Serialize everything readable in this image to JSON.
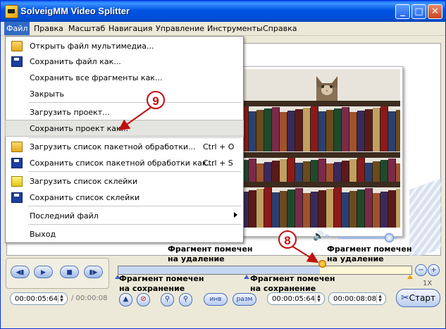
{
  "window": {
    "title": "SolveigMM Video Splitter",
    "buttons": {
      "minimize": "_",
      "maximize": "□",
      "close": "✕"
    }
  },
  "menubar": {
    "items": [
      "Файл",
      "Правка",
      "Масштаб",
      "Навигация",
      "Управление",
      "Инструменты",
      "Справка"
    ]
  },
  "file_menu": {
    "items": [
      {
        "label": "Открыть файл мультимедиа...",
        "icon": "folder-open-icon"
      },
      {
        "label": "Сохранить файл как...",
        "icon": "floppy-disk-icon"
      },
      {
        "label": "Сохранить все фрагменты как..."
      },
      {
        "label": "Закрыть"
      },
      {
        "label": "Загрузить проект..."
      },
      {
        "label": "Сохранить проект как...",
        "highlighted": true
      },
      {
        "label": "Загрузить список пакетной обработки...",
        "shortcut": "Ctrl + O",
        "icon": "folder-open-icon"
      },
      {
        "label": "Сохранить список пакетной обработки как...",
        "shortcut": "Ctrl + S",
        "icon": "floppy-disk-icon"
      },
      {
        "label": "Загрузить список склейки",
        "icon": "yellow-folder-icon"
      },
      {
        "label": "Сохранить список склейки",
        "icon": "floppy-disk-icon"
      },
      {
        "label": "Последний файл",
        "submenu": true
      },
      {
        "label": "Выход"
      }
    ]
  },
  "callouts": {
    "nine": "9",
    "eight": "8"
  },
  "timeline": {
    "label_delete_1": [
      "Фрагмент помечен",
      "на удаление"
    ],
    "label_delete_2": [
      "Фрагмент помечен",
      "на удаление"
    ],
    "label_keep_1": [
      "Фрагмент помечен",
      "на сохранение"
    ],
    "label_keep_2": [
      "Фрагмент помечен",
      "на сохранение"
    ],
    "speed": "1X"
  },
  "controls": {
    "current_time": "00:00:05:64",
    "total_time": "/ 00:00:08",
    "mark_in_time": "00:00:05:64",
    "mark_out_time": "00:00:08:08",
    "inv_label": "инв",
    "split_label": "разм",
    "start_label": "Старт",
    "zoom_minus": "−",
    "zoom_plus": "+"
  },
  "colors": {
    "titlebar": "#0054e3",
    "menu_highlight": "#316ac5",
    "callout": "#c01010",
    "timeline_keep": "#c6d7f2",
    "timeline_delete": "#fff8d6"
  }
}
